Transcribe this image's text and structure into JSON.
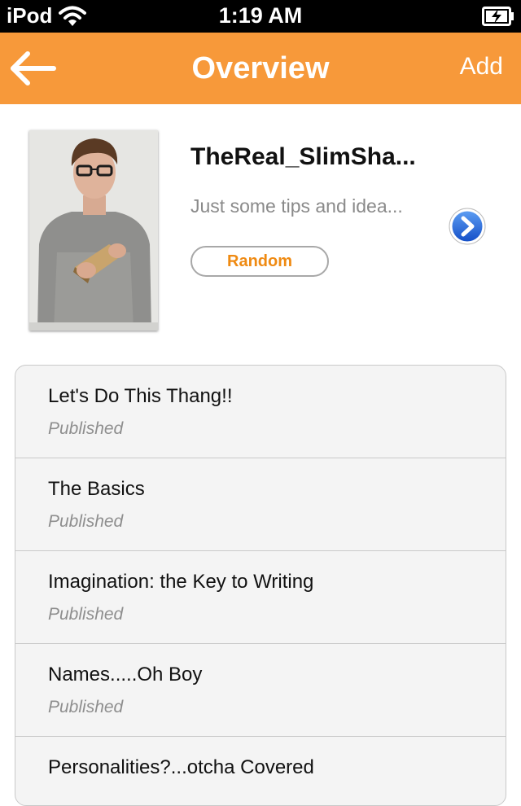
{
  "status_bar": {
    "carrier": "iPod",
    "time": "1:19 AM",
    "wifi_icon": "wifi-icon",
    "battery_icon": "battery-charging-icon"
  },
  "nav": {
    "back_icon": "back-arrow-icon",
    "title": "Overview",
    "add_label": "Add",
    "background_color": "#f7993a"
  },
  "profile": {
    "avatar_icon": "profile-photo",
    "username": "TheReal_SlimSha...",
    "description": "Just some tips and idea...",
    "tag_label": "Random",
    "tag_color": "#ef8a12",
    "disclosure_icon": "chevron-right-circle-icon"
  },
  "stories": [
    {
      "title": "Let's Do This Thang!!",
      "status": "Published"
    },
    {
      "title": "The Basics",
      "status": "Published"
    },
    {
      "title": "Imagination: the Key to Writing",
      "status": "Published"
    },
    {
      "title": "Names.....Oh Boy",
      "status": "Published"
    },
    {
      "title": "Personalities?...otcha Covered",
      "status": ""
    }
  ]
}
